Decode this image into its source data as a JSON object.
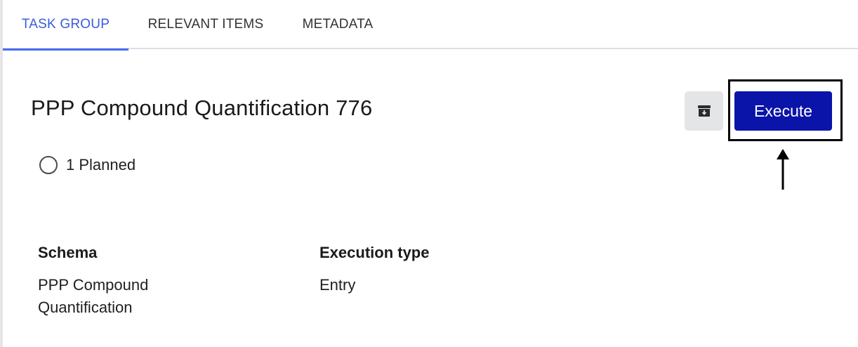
{
  "tabs": [
    {
      "label": "TASK GROUP",
      "active": true
    },
    {
      "label": "RELEVANT ITEMS",
      "active": false
    },
    {
      "label": "METADATA",
      "active": false
    }
  ],
  "header": {
    "title": "PPP Compound Quantification 776",
    "archive_icon": "archive-icon",
    "execute_label": "Execute"
  },
  "status": {
    "text": "1 Planned"
  },
  "fields": {
    "schema": {
      "label": "Schema",
      "value": "PPP Compound Quantification"
    },
    "execution_type": {
      "label": "Execution type",
      "value": "Entry"
    }
  },
  "colors": {
    "accent": "#3b5bdb",
    "execute_button": "#0a14a8",
    "archive_button_bg": "#e4e5e7"
  }
}
